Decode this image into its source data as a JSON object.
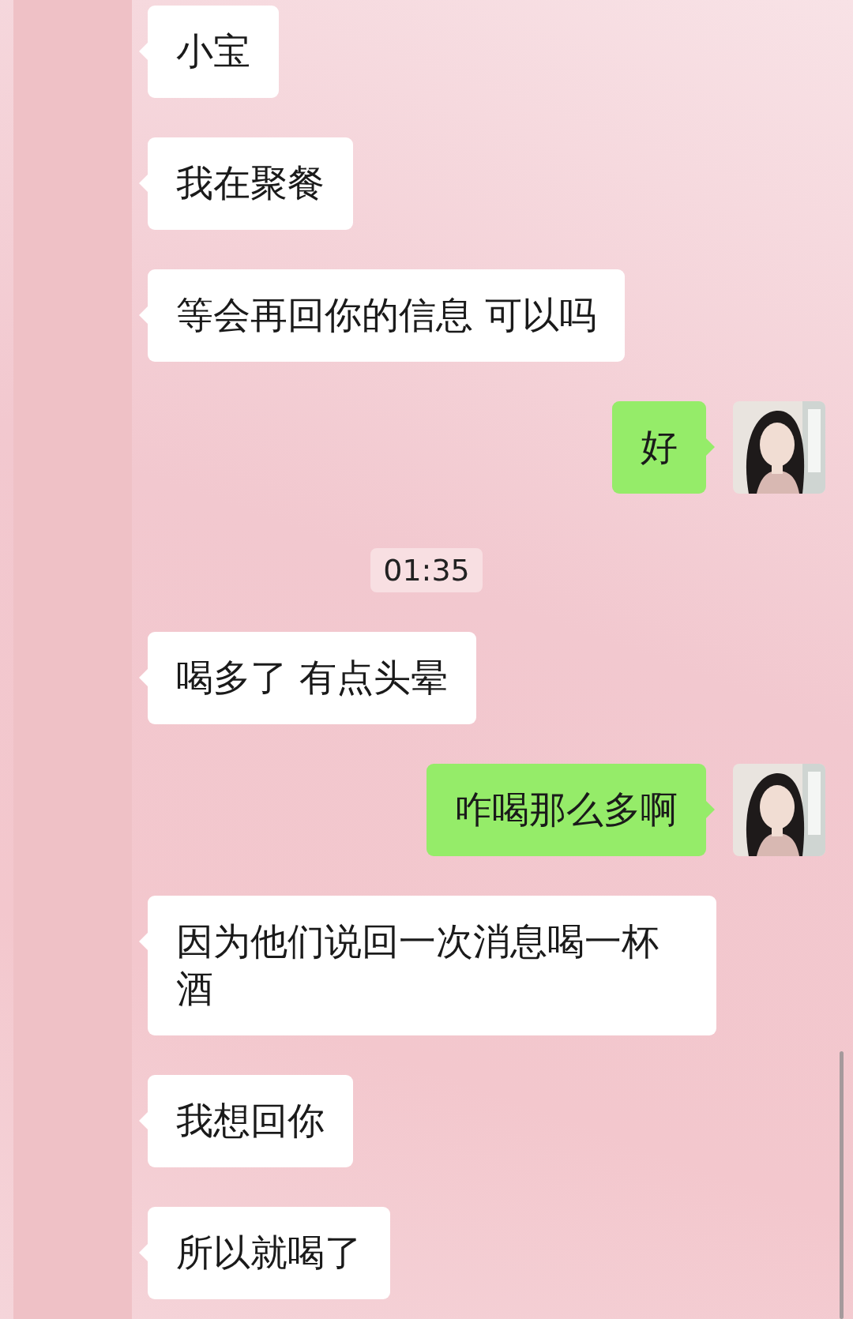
{
  "messages": [
    {
      "kind": "incoming",
      "text": "小宝"
    },
    {
      "kind": "incoming",
      "text": "我在聚餐"
    },
    {
      "kind": "incoming",
      "text": "等会再回你的信息 可以吗"
    },
    {
      "kind": "outgoing",
      "text": "好"
    },
    {
      "kind": "timestamp",
      "text": "01:35"
    },
    {
      "kind": "incoming",
      "text": "喝多了 有点头晕"
    },
    {
      "kind": "outgoing",
      "text": "咋喝那么多啊"
    },
    {
      "kind": "incoming",
      "text": "因为他们说回一次消息喝一杯酒"
    },
    {
      "kind": "incoming",
      "text": "我想回你"
    },
    {
      "kind": "incoming",
      "text": "所以就喝了"
    }
  ]
}
